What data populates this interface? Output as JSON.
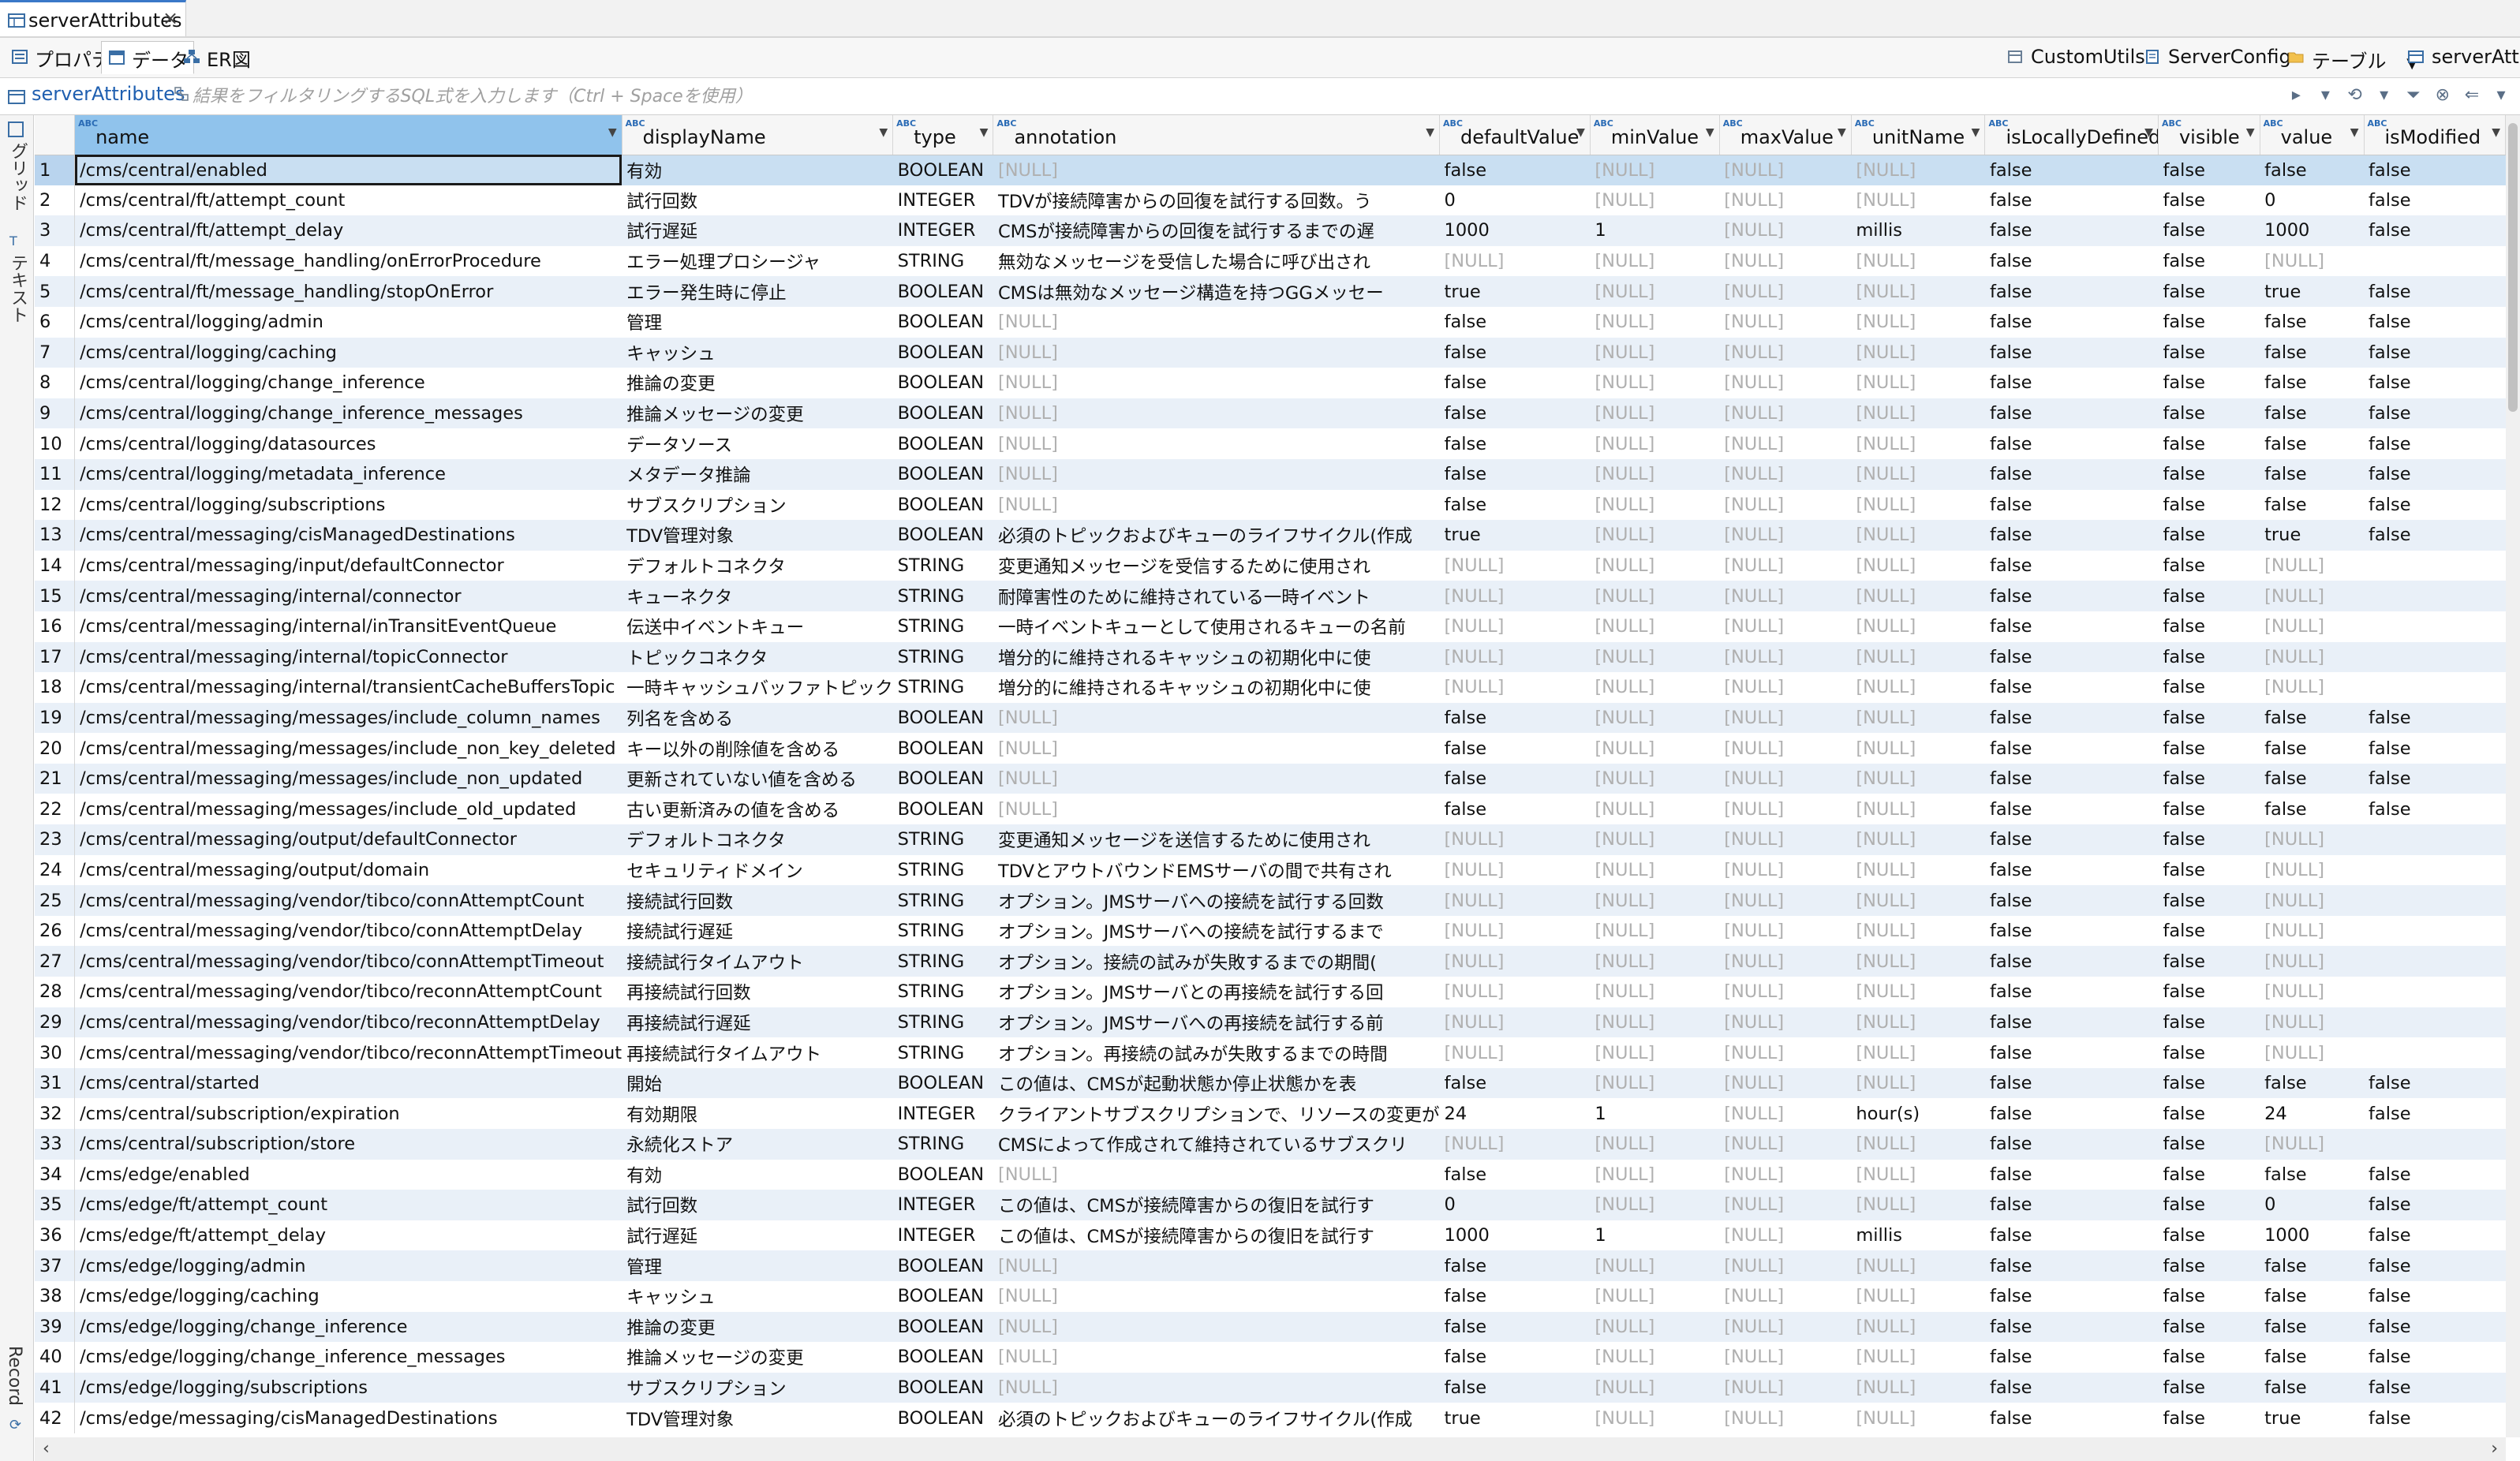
{
  "editor_tab": {
    "label": "serverAttributes",
    "close": "×"
  },
  "view_tabs": [
    {
      "label": "プロパティ"
    },
    {
      "label": "データ"
    },
    {
      "label": "ER図"
    }
  ],
  "right_tools": [
    {
      "label": "CustomUtils"
    },
    {
      "label": "ServerConfig"
    },
    {
      "label": "テーブル"
    },
    {
      "label": "serverAttrib"
    }
  ],
  "filter": {
    "table_name": "serverAttributes",
    "placeholder": "結果をフィルタリングするSQL式を入力します（Ctrl + Spaceを使用）"
  },
  "left_strip": {
    "grid": "グリッド",
    "text": "テキスト",
    "record": "Record"
  },
  "columns": [
    "name",
    "displayName",
    "type",
    "annotation",
    "defaultValue",
    "minValue",
    "maxValue",
    "unitName",
    "isLocallyDefined",
    "visible",
    "value",
    "isModified"
  ],
  "rows": [
    [
      "1",
      "/cms/central/enabled",
      "有効",
      "BOOLEAN",
      "[NULL]",
      "false",
      "[NULL]",
      "[NULL]",
      "[NULL]",
      "false",
      "false",
      "false",
      "false"
    ],
    [
      "2",
      "/cms/central/ft/attempt_count",
      "試行回数",
      "INTEGER",
      "TDVが接続障害からの回復を試行する回数。う",
      "0",
      "[NULL]",
      "[NULL]",
      "[NULL]",
      "false",
      "false",
      "0",
      "false"
    ],
    [
      "3",
      "/cms/central/ft/attempt_delay",
      "試行遅延",
      "INTEGER",
      "CMSが接続障害からの回復を試行するまでの遅",
      "1000",
      "1",
      "[NULL]",
      "millis",
      "false",
      "false",
      "1000",
      "false"
    ],
    [
      "4",
      "/cms/central/ft/message_handling/onErrorProcedure",
      "エラー処理プロシージャ",
      "STRING",
      "無効なメッセージを受信した場合に呼び出され",
      "[NULL]",
      "[NULL]",
      "[NULL]",
      "[NULL]",
      "false",
      "false",
      "[NULL]",
      ""
    ],
    [
      "5",
      "/cms/central/ft/message_handling/stopOnError",
      "エラー発生時に停止",
      "BOOLEAN",
      "CMSは無効なメッセージ構造を持つGGメッセー",
      "true",
      "[NULL]",
      "[NULL]",
      "[NULL]",
      "false",
      "false",
      "true",
      "false"
    ],
    [
      "6",
      "/cms/central/logging/admin",
      "管理",
      "BOOLEAN",
      "[NULL]",
      "false",
      "[NULL]",
      "[NULL]",
      "[NULL]",
      "false",
      "false",
      "false",
      "false"
    ],
    [
      "7",
      "/cms/central/logging/caching",
      "キャッシュ",
      "BOOLEAN",
      "[NULL]",
      "false",
      "[NULL]",
      "[NULL]",
      "[NULL]",
      "false",
      "false",
      "false",
      "false"
    ],
    [
      "8",
      "/cms/central/logging/change_inference",
      "推論の変更",
      "BOOLEAN",
      "[NULL]",
      "false",
      "[NULL]",
      "[NULL]",
      "[NULL]",
      "false",
      "false",
      "false",
      "false"
    ],
    [
      "9",
      "/cms/central/logging/change_inference_messages",
      "推論メッセージの変更",
      "BOOLEAN",
      "[NULL]",
      "false",
      "[NULL]",
      "[NULL]",
      "[NULL]",
      "false",
      "false",
      "false",
      "false"
    ],
    [
      "10",
      "/cms/central/logging/datasources",
      "データソース",
      "BOOLEAN",
      "[NULL]",
      "false",
      "[NULL]",
      "[NULL]",
      "[NULL]",
      "false",
      "false",
      "false",
      "false"
    ],
    [
      "11",
      "/cms/central/logging/metadata_inference",
      "メタデータ推論",
      "BOOLEAN",
      "[NULL]",
      "false",
      "[NULL]",
      "[NULL]",
      "[NULL]",
      "false",
      "false",
      "false",
      "false"
    ],
    [
      "12",
      "/cms/central/logging/subscriptions",
      "サブスクリプション",
      "BOOLEAN",
      "[NULL]",
      "false",
      "[NULL]",
      "[NULL]",
      "[NULL]",
      "false",
      "false",
      "false",
      "false"
    ],
    [
      "13",
      "/cms/central/messaging/cisManagedDestinations",
      "TDV管理対象",
      "BOOLEAN",
      "必須のトピックおよびキューのライフサイクル(作成",
      "true",
      "[NULL]",
      "[NULL]",
      "[NULL]",
      "false",
      "false",
      "true",
      "false"
    ],
    [
      "14",
      "/cms/central/messaging/input/defaultConnector",
      "デフォルトコネクタ",
      "STRING",
      "変更通知メッセージを受信するために使用され",
      "[NULL]",
      "[NULL]",
      "[NULL]",
      "[NULL]",
      "false",
      "false",
      "[NULL]",
      ""
    ],
    [
      "15",
      "/cms/central/messaging/internal/connector",
      "キューネクタ",
      "STRING",
      "耐障害性のために維持されている一時イベント",
      "[NULL]",
      "[NULL]",
      "[NULL]",
      "[NULL]",
      "false",
      "false",
      "[NULL]",
      ""
    ],
    [
      "16",
      "/cms/central/messaging/internal/inTransitEventQueue",
      "伝送中イベントキュー",
      "STRING",
      "一時イベントキューとして使用されるキューの名前",
      "[NULL]",
      "[NULL]",
      "[NULL]",
      "[NULL]",
      "false",
      "false",
      "[NULL]",
      ""
    ],
    [
      "17",
      "/cms/central/messaging/internal/topicConnector",
      "トピックコネクタ",
      "STRING",
      "増分的に維持されるキャッシュの初期化中に使",
      "[NULL]",
      "[NULL]",
      "[NULL]",
      "[NULL]",
      "false",
      "false",
      "[NULL]",
      ""
    ],
    [
      "18",
      "/cms/central/messaging/internal/transientCacheBuffersTopic",
      "一時キャッシュバッファトピック",
      "STRING",
      "増分的に維持されるキャッシュの初期化中に使",
      "[NULL]",
      "[NULL]",
      "[NULL]",
      "[NULL]",
      "false",
      "false",
      "[NULL]",
      ""
    ],
    [
      "19",
      "/cms/central/messaging/messages/include_column_names",
      "列名を含める",
      "BOOLEAN",
      "[NULL]",
      "false",
      "[NULL]",
      "[NULL]",
      "[NULL]",
      "false",
      "false",
      "false",
      "false"
    ],
    [
      "20",
      "/cms/central/messaging/messages/include_non_key_deleted",
      "キー以外の削除値を含める",
      "BOOLEAN",
      "[NULL]",
      "false",
      "[NULL]",
      "[NULL]",
      "[NULL]",
      "false",
      "false",
      "false",
      "false"
    ],
    [
      "21",
      "/cms/central/messaging/messages/include_non_updated",
      "更新されていない値を含める",
      "BOOLEAN",
      "[NULL]",
      "false",
      "[NULL]",
      "[NULL]",
      "[NULL]",
      "false",
      "false",
      "false",
      "false"
    ],
    [
      "22",
      "/cms/central/messaging/messages/include_old_updated",
      "古い更新済みの値を含める",
      "BOOLEAN",
      "[NULL]",
      "false",
      "[NULL]",
      "[NULL]",
      "[NULL]",
      "false",
      "false",
      "false",
      "false"
    ],
    [
      "23",
      "/cms/central/messaging/output/defaultConnector",
      "デフォルトコネクタ",
      "STRING",
      "変更通知メッセージを送信するために使用され",
      "[NULL]",
      "[NULL]",
      "[NULL]",
      "[NULL]",
      "false",
      "false",
      "[NULL]",
      ""
    ],
    [
      "24",
      "/cms/central/messaging/output/domain",
      "セキュリティドメイン",
      "STRING",
      "TDVとアウトバウンドEMSサーバの間で共有され",
      "[NULL]",
      "[NULL]",
      "[NULL]",
      "[NULL]",
      "false",
      "false",
      "[NULL]",
      ""
    ],
    [
      "25",
      "/cms/central/messaging/vendor/tibco/connAttemptCount",
      "接続試行回数",
      "STRING",
      "オプション。JMSサーバへの接続を試行する回数",
      "[NULL]",
      "[NULL]",
      "[NULL]",
      "[NULL]",
      "false",
      "false",
      "[NULL]",
      ""
    ],
    [
      "26",
      "/cms/central/messaging/vendor/tibco/connAttemptDelay",
      "接続試行遅延",
      "STRING",
      "オプション。JMSサーバへの接続を試行するまで",
      "[NULL]",
      "[NULL]",
      "[NULL]",
      "[NULL]",
      "false",
      "false",
      "[NULL]",
      ""
    ],
    [
      "27",
      "/cms/central/messaging/vendor/tibco/connAttemptTimeout",
      "接続試行タイムアウト",
      "STRING",
      "オプション。接続の試みが失敗するまでの期間(",
      "[NULL]",
      "[NULL]",
      "[NULL]",
      "[NULL]",
      "false",
      "false",
      "[NULL]",
      ""
    ],
    [
      "28",
      "/cms/central/messaging/vendor/tibco/reconnAttemptCount",
      "再接続試行回数",
      "STRING",
      "オプション。JMSサーバとの再接続を試行する回",
      "[NULL]",
      "[NULL]",
      "[NULL]",
      "[NULL]",
      "false",
      "false",
      "[NULL]",
      ""
    ],
    [
      "29",
      "/cms/central/messaging/vendor/tibco/reconnAttemptDelay",
      "再接続試行遅延",
      "STRING",
      "オプション。JMSサーバへの再接続を試行する前",
      "[NULL]",
      "[NULL]",
      "[NULL]",
      "[NULL]",
      "false",
      "false",
      "[NULL]",
      ""
    ],
    [
      "30",
      "/cms/central/messaging/vendor/tibco/reconnAttemptTimeout",
      "再接続試行タイムアウト",
      "STRING",
      "オプション。再接続の試みが失敗するまでの時間",
      "[NULL]",
      "[NULL]",
      "[NULL]",
      "[NULL]",
      "false",
      "false",
      "[NULL]",
      ""
    ],
    [
      "31",
      "/cms/central/started",
      "開始",
      "BOOLEAN",
      "この値は、CMSが起動状態か停止状態かを表",
      "false",
      "[NULL]",
      "[NULL]",
      "[NULL]",
      "false",
      "false",
      "false",
      "false"
    ],
    [
      "32",
      "/cms/central/subscription/expiration",
      "有効期限",
      "INTEGER",
      "クライアントサブスクリプションで、リソースの変更が",
      "24",
      "1",
      "[NULL]",
      "hour(s)",
      "false",
      "false",
      "24",
      "false"
    ],
    [
      "33",
      "/cms/central/subscription/store",
      "永続化ストア",
      "STRING",
      "CMSによって作成されて維持されているサブスクリ",
      "[NULL]",
      "[NULL]",
      "[NULL]",
      "[NULL]",
      "false",
      "false",
      "[NULL]",
      ""
    ],
    [
      "34",
      "/cms/edge/enabled",
      "有効",
      "BOOLEAN",
      "[NULL]",
      "false",
      "[NULL]",
      "[NULL]",
      "[NULL]",
      "false",
      "false",
      "false",
      "false"
    ],
    [
      "35",
      "/cms/edge/ft/attempt_count",
      "試行回数",
      "INTEGER",
      "この値は、CMSが接続障害からの復旧を試行す",
      "0",
      "[NULL]",
      "[NULL]",
      "[NULL]",
      "false",
      "false",
      "0",
      "false"
    ],
    [
      "36",
      "/cms/edge/ft/attempt_delay",
      "試行遅延",
      "INTEGER",
      "この値は、CMSが接続障害からの復旧を試行す",
      "1000",
      "1",
      "[NULL]",
      "millis",
      "false",
      "false",
      "1000",
      "false"
    ],
    [
      "37",
      "/cms/edge/logging/admin",
      "管理",
      "BOOLEAN",
      "[NULL]",
      "false",
      "[NULL]",
      "[NULL]",
      "[NULL]",
      "false",
      "false",
      "false",
      "false"
    ],
    [
      "38",
      "/cms/edge/logging/caching",
      "キャッシュ",
      "BOOLEAN",
      "[NULL]",
      "false",
      "[NULL]",
      "[NULL]",
      "[NULL]",
      "false",
      "false",
      "false",
      "false"
    ],
    [
      "39",
      "/cms/edge/logging/change_inference",
      "推論の変更",
      "BOOLEAN",
      "[NULL]",
      "false",
      "[NULL]",
      "[NULL]",
      "[NULL]",
      "false",
      "false",
      "false",
      "false"
    ],
    [
      "40",
      "/cms/edge/logging/change_inference_messages",
      "推論メッセージの変更",
      "BOOLEAN",
      "[NULL]",
      "false",
      "[NULL]",
      "[NULL]",
      "[NULL]",
      "false",
      "false",
      "false",
      "false"
    ],
    [
      "41",
      "/cms/edge/logging/subscriptions",
      "サブスクリプション",
      "BOOLEAN",
      "[NULL]",
      "false",
      "[NULL]",
      "[NULL]",
      "[NULL]",
      "false",
      "false",
      "false",
      "false"
    ],
    [
      "42",
      "/cms/edge/messaging/cisManagedDestinations",
      "TDV管理対象",
      "BOOLEAN",
      "必須のトピックおよびキューのライフサイクル(作成",
      "true",
      "[NULL]",
      "[NULL]",
      "[NULL]",
      "false",
      "false",
      "true",
      "false"
    ]
  ]
}
